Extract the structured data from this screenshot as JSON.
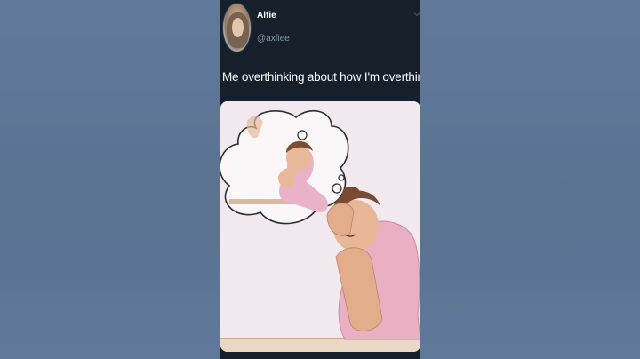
{
  "tweet": {
    "display_name": "Alfie",
    "handle": "@axfiee",
    "text": "Me overthinking about how I'm overthinking",
    "menu_icon": "chevron-down-icon",
    "avatar_icon": "profile-avatar"
  },
  "colors": {
    "background": "#5d7591",
    "tweet_bg": "#15202b",
    "text_primary": "#ffffff",
    "text_secondary": "#8899a6"
  }
}
